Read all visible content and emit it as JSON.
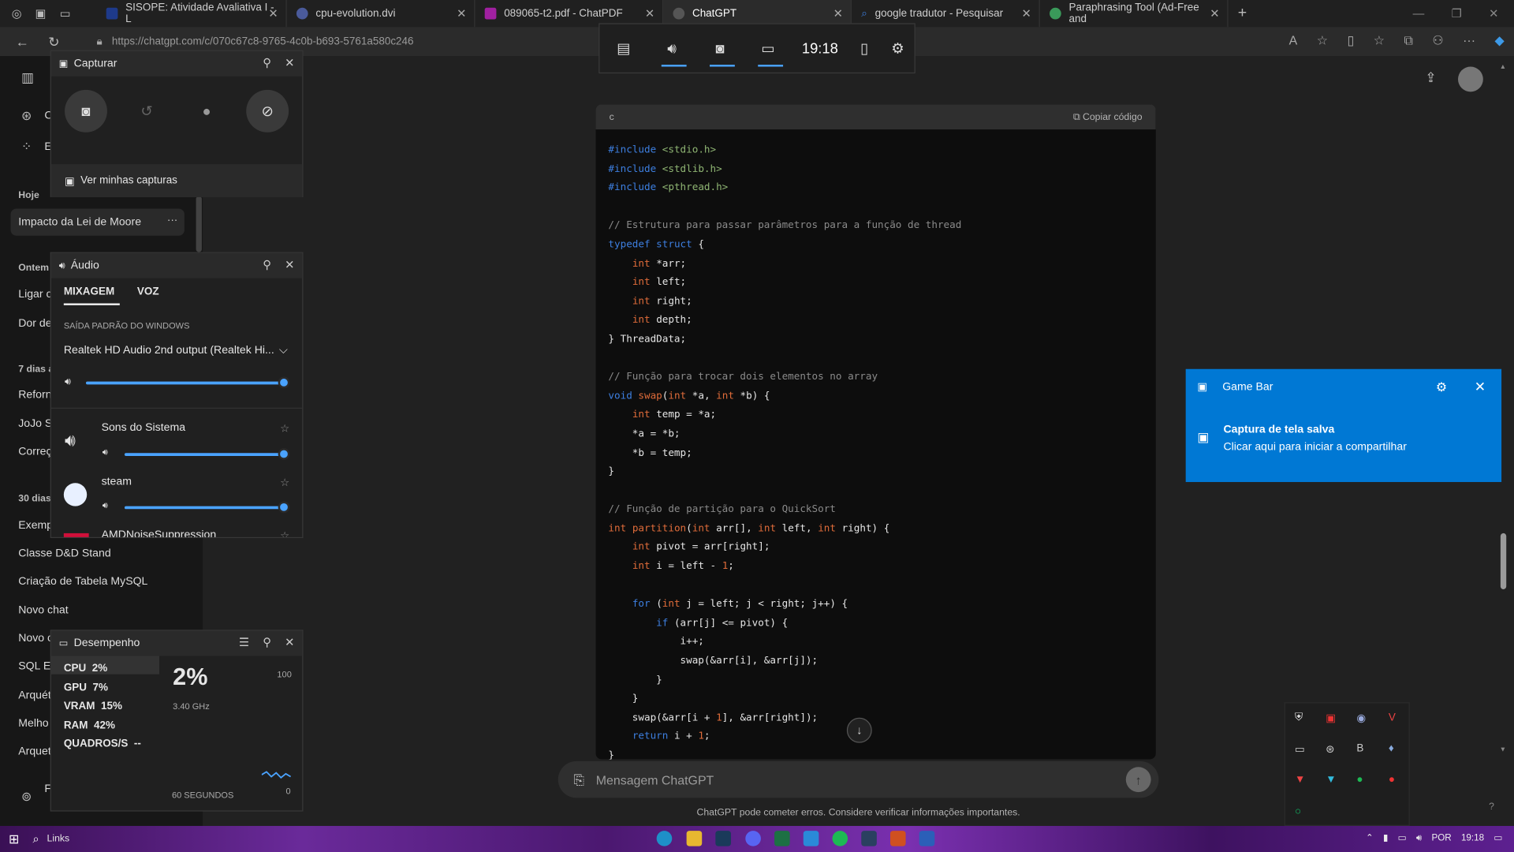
{
  "browser": {
    "tabs": [
      {
        "label": "SISOPE: Atividade Avaliativa I - L",
        "color": "#1e3a8a"
      },
      {
        "label": "cpu-evolution.dvi",
        "color": "#4a5a9a"
      },
      {
        "label": "089065-t2.pdf - ChatPDF",
        "color": "#a020a0"
      },
      {
        "label": "ChatGPT",
        "color": "#444444",
        "active": true
      },
      {
        "label": "google tradutor - Pesquisar",
        "color": "#3d7fe0"
      },
      {
        "label": "Paraphrasing Tool (Ad-Free and",
        "color": "#3a9a5a"
      }
    ],
    "url": "https://chatgpt.com/c/070c67c8-9765-4c0b-b693-5761a580c246"
  },
  "sidebar": {
    "sections": [
      {
        "head": "Hoje",
        "items": [
          "Impacto da Lei de Moore"
        ]
      },
      {
        "head": "Ontem",
        "items": [
          "Ligar c",
          "Dor de"
        ]
      },
      {
        "head": "7 dias a",
        "items": [
          "Reforn",
          "JoJo St",
          "Correç"
        ]
      },
      {
        "head": "30 dias",
        "items": [
          "Exemp",
          "Classe D&D Stand",
          "Criação de Tabela MySQL",
          "Novo chat",
          "Novo c",
          "SQL Er",
          "Arquét",
          "Melho",
          "Arquet"
        ]
      }
    ],
    "more": "···",
    "top_items": [
      "C",
      "E"
    ],
    "bottom_item": "F"
  },
  "code": {
    "lang": "c",
    "copy_label": "Copiar código"
  },
  "composer": {
    "placeholder": "Mensagem ChatGPT",
    "disclaimer": "ChatGPT pode cometer erros. Considere verificar informações importantes."
  },
  "gamebar_top": {
    "time": "19:18"
  },
  "capture": {
    "title": "Capturar",
    "link": "Ver minhas capturas"
  },
  "audio": {
    "title": "Áudio",
    "tabs": [
      "MIXAGEM",
      "VOZ"
    ],
    "output_label": "SAÍDA PADRÃO DO WINDOWS",
    "device": "Realtek HD Audio 2nd output (Realtek Hi...",
    "master_level": 1.0,
    "apps": [
      {
        "name": "Sons do Sistema",
        "level": 1.0
      },
      {
        "name": "steam",
        "level": 1.0
      },
      {
        "name": "AMDNoiseSuppression",
        "level": 1.0
      }
    ]
  },
  "perf": {
    "title": "Desempenho",
    "rows": [
      {
        "label": "CPU",
        "value": "2%"
      },
      {
        "label": "GPU",
        "value": "7%"
      },
      {
        "label": "VRAM",
        "value": "15%"
      },
      {
        "label": "RAM",
        "value": "42%"
      },
      {
        "label": "QUADROS/S",
        "value": "--"
      }
    ],
    "big": "2%",
    "freq": "3.40 GHz",
    "max": "100",
    "min": "0",
    "span": "60 SEGUNDOS"
  },
  "notification": {
    "app": "Game Bar",
    "title": "Captura de tela salva",
    "body": "Clicar aqui para iniciar a compartilhar"
  },
  "taskbar": {
    "links": "Links",
    "lang": "POR",
    "time": "19:18"
  }
}
